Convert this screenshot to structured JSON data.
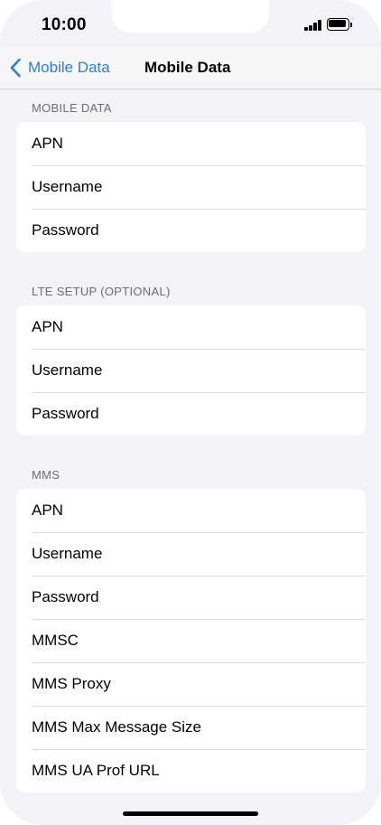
{
  "status_bar": {
    "time": "10:00",
    "signal_icon": "cellular-signal-icon",
    "battery_icon": "battery-full-icon"
  },
  "nav": {
    "back_label": "Mobile Data",
    "title": "Mobile Data",
    "back_icon": "chevron-left-icon",
    "accent_color": "#2a7de1"
  },
  "sections": {
    "mobile_data": {
      "header": "MOBILE DATA",
      "rows": [
        "APN",
        "Username",
        "Password"
      ]
    },
    "lte_setup": {
      "header": "LTE SETUP (OPTIONAL)",
      "rows": [
        "APN",
        "Username",
        "Password"
      ]
    },
    "mms": {
      "header": "MMS",
      "rows": [
        "APN",
        "Username",
        "Password",
        "MMSC",
        "MMS Proxy",
        "MMS Max Message Size",
        "MMS UA Prof URL"
      ]
    }
  },
  "colors": {
    "background": "#f2f2f7",
    "group_background": "#ffffff",
    "section_header": "#6d6d72"
  }
}
